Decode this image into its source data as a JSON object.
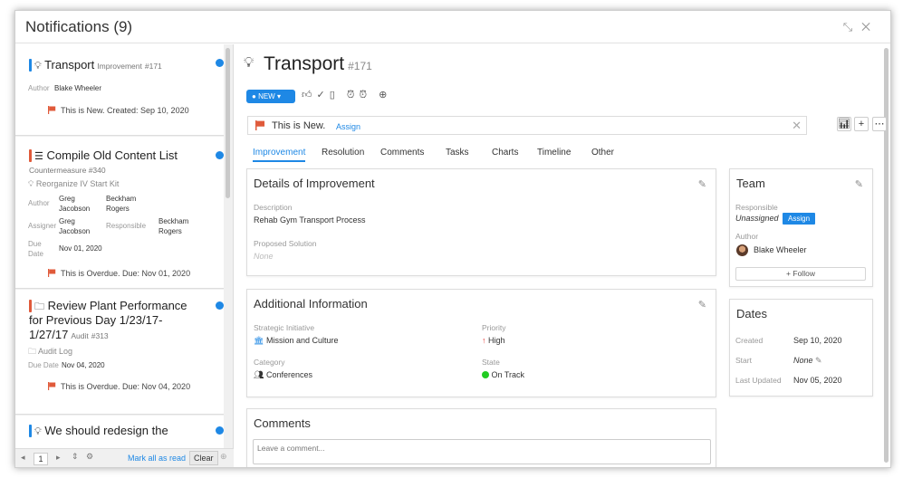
{
  "window": {
    "title": "Notifications (9)"
  },
  "notifications": [
    {
      "title": "Transport",
      "type": "Improvement",
      "id": "#171",
      "author_label": "Author",
      "author": "Blake Wheeler",
      "message": "This is New. Created: Sep 10, 2020",
      "bar_color": "#1e88e5"
    },
    {
      "title": "Compile Old Content List",
      "type": "Countermeasure",
      "id": "#340",
      "parent": "Reorganize IV Start Kit",
      "author_label": "Author",
      "author_1": "Greg",
      "author_2": "Jacobson",
      "author_b1": "Beckham",
      "author_b2": "Rogers",
      "assigner_label": "Assigner",
      "assigner_1": "Greg",
      "assigner_2": "Jacobson",
      "responsible_label": "Responsible",
      "responsible_1": "Beckham",
      "responsible_2": "Rogers",
      "due_label_1": "Due",
      "due_label_2": "Date",
      "due": "Nov 01, 2020",
      "message": "This is Overdue. Due: Nov 01, 2020",
      "bar_color": "#e05a3a"
    },
    {
      "title_1": "Review Plant Performance",
      "title_2": "for Previous Day 1/23/17-",
      "title_3": "1/27/17",
      "type": "Audit",
      "id": "#313",
      "parent": "Audit Log",
      "due_label": "Due Date",
      "due": "Nov 04, 2020",
      "message": "This is Overdue. Due: Nov 04, 2020",
      "bar_color": "#e05a3a"
    },
    {
      "title": "We should redesign the",
      "bar_color": "#1e88e5"
    }
  ],
  "footer": {
    "page": "1",
    "mark_all": "Mark all as read",
    "clear": "Clear"
  },
  "detail": {
    "title": "Transport",
    "id": "#171",
    "status": "NEW",
    "new_message": "This is New.",
    "assign_link": "Assign",
    "tabs": [
      "Improvement",
      "Resolution",
      "Comments",
      "Tasks",
      "Charts",
      "Timeline",
      "Other"
    ],
    "details": {
      "heading": "Details of Improvement",
      "description_label": "Description",
      "description": "Rehab Gym Transport Process",
      "proposed_label": "Proposed Solution",
      "proposed": "None"
    },
    "additional": {
      "heading": "Additional Information",
      "strategic_label": "Strategic Initiative",
      "strategic": "Mission and Culture",
      "priority_label": "Priority",
      "priority": "High",
      "category_label": "Category",
      "category": "Conferences",
      "state_label": "State",
      "state": "On Track"
    },
    "comments": {
      "heading": "Comments",
      "placeholder": "Leave a comment..."
    },
    "team": {
      "heading": "Team",
      "responsible_label": "Responsible",
      "responsible": "Unassigned",
      "assign": "Assign",
      "author_label": "Author",
      "author": "Blake Wheeler",
      "follow": "Follow"
    },
    "dates": {
      "heading": "Dates",
      "created_label": "Created",
      "created": "Sep 10, 2020",
      "start_label": "Start",
      "start": "None",
      "updated_label": "Last Updated",
      "updated": "Nov 05, 2020"
    }
  },
  "colors": {
    "accent": "#1e88e5",
    "flag": "#e05a3a",
    "ontrack": "#22cc22",
    "priority_high": "#e53935"
  }
}
